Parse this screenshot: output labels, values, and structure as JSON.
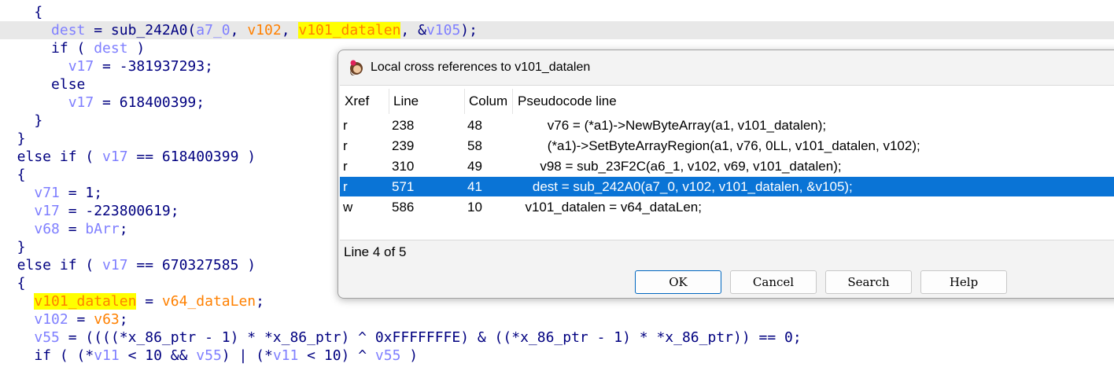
{
  "code_lines": [
    {
      "tokens": [
        {
          "t": "    {",
          "c": "t"
        }
      ]
    },
    {
      "highlighted": true,
      "tokens": [
        {
          "t": "      ",
          "c": "t"
        },
        {
          "t": "dest",
          "c": "v"
        },
        {
          "t": " = sub_242A0(",
          "c": "t"
        },
        {
          "t": "a7_0",
          "c": "v"
        },
        {
          "t": ", ",
          "c": "t"
        },
        {
          "t": "v102",
          "c": "o"
        },
        {
          "t": ", ",
          "c": "t"
        },
        {
          "t": "v101_datalen",
          "c": "y"
        },
        {
          "t": ", &",
          "c": "t"
        },
        {
          "t": "v105",
          "c": "v"
        },
        {
          "t": ");",
          "c": "t"
        }
      ]
    },
    {
      "tokens": [
        {
          "t": "      if ( ",
          "c": "t"
        },
        {
          "t": "dest",
          "c": "v"
        },
        {
          "t": " )",
          "c": "t"
        }
      ]
    },
    {
      "tokens": [
        {
          "t": "        ",
          "c": "t"
        },
        {
          "t": "v17",
          "c": "v"
        },
        {
          "t": " = -381937293;",
          "c": "t"
        }
      ]
    },
    {
      "tokens": [
        {
          "t": "      else",
          "c": "t"
        }
      ]
    },
    {
      "tokens": [
        {
          "t": "        ",
          "c": "t"
        },
        {
          "t": "v17",
          "c": "v"
        },
        {
          "t": " = 618400399;",
          "c": "t"
        }
      ]
    },
    {
      "tokens": [
        {
          "t": "    }",
          "c": "t"
        }
      ]
    },
    {
      "tokens": [
        {
          "t": "  }",
          "c": "t"
        }
      ]
    },
    {
      "tokens": [
        {
          "t": "  else if ( ",
          "c": "t"
        },
        {
          "t": "v17",
          "c": "v"
        },
        {
          "t": " == 618400399 )",
          "c": "t"
        }
      ]
    },
    {
      "tokens": [
        {
          "t": "  {",
          "c": "t"
        }
      ]
    },
    {
      "tokens": [
        {
          "t": "    ",
          "c": "t"
        },
        {
          "t": "v71",
          "c": "v"
        },
        {
          "t": " = 1;",
          "c": "t"
        }
      ]
    },
    {
      "tokens": [
        {
          "t": "    ",
          "c": "t"
        },
        {
          "t": "v17",
          "c": "v"
        },
        {
          "t": " = -223800619;",
          "c": "t"
        }
      ]
    },
    {
      "tokens": [
        {
          "t": "    ",
          "c": "t"
        },
        {
          "t": "v68",
          "c": "v"
        },
        {
          "t": " = ",
          "c": "t"
        },
        {
          "t": "bArr",
          "c": "v"
        },
        {
          "t": ";",
          "c": "t"
        }
      ]
    },
    {
      "tokens": [
        {
          "t": "  }",
          "c": "t"
        }
      ]
    },
    {
      "tokens": [
        {
          "t": "  else if ( ",
          "c": "t"
        },
        {
          "t": "v17",
          "c": "v"
        },
        {
          "t": " == 670327585 )",
          "c": "t"
        }
      ]
    },
    {
      "tokens": [
        {
          "t": "  {",
          "c": "t"
        }
      ]
    },
    {
      "tokens": [
        {
          "t": "    ",
          "c": "t"
        },
        {
          "t": "v101_datalen",
          "c": "y"
        },
        {
          "t": " = ",
          "c": "t"
        },
        {
          "t": "v64_dataLen",
          "c": "o"
        },
        {
          "t": ";",
          "c": "t"
        }
      ]
    },
    {
      "tokens": [
        {
          "t": "    ",
          "c": "t"
        },
        {
          "t": "v102",
          "c": "v"
        },
        {
          "t": " = ",
          "c": "t"
        },
        {
          "t": "v63",
          "c": "o"
        },
        {
          "t": ";",
          "c": "t"
        }
      ]
    },
    {
      "tokens": [
        {
          "t": "    ",
          "c": "t"
        },
        {
          "t": "v55",
          "c": "v"
        },
        {
          "t": " = ((((*x_86_ptr - 1) * *x_86_ptr) ^ 0xFFFFFFFE) & ((*x_86_ptr - 1) * *x_86_ptr)) == 0;",
          "c": "t"
        }
      ]
    },
    {
      "tokens": [
        {
          "t": "    if ( (*",
          "c": "t"
        },
        {
          "t": "v11",
          "c": "v"
        },
        {
          "t": " < 10 && ",
          "c": "t"
        },
        {
          "t": "v55",
          "c": "v"
        },
        {
          "t": ") | (*",
          "c": "t"
        },
        {
          "t": "v11",
          "c": "v"
        },
        {
          "t": " < 10) ^ ",
          "c": "t"
        },
        {
          "t": "v55",
          "c": "v"
        },
        {
          "t": " )",
          "c": "t"
        }
      ]
    }
  ],
  "dialog": {
    "title": "Local cross references to v101_datalen",
    "columns": {
      "xref": "Xref",
      "line": "Line",
      "column": "Colum",
      "pseudocode": "Pseudocode line"
    },
    "rows": [
      {
        "xref": "r",
        "line": "238",
        "column": "48",
        "code": "        v76 = (*a1)->NewByteArray(a1, v101_datalen);",
        "selected": false
      },
      {
        "xref": "r",
        "line": "239",
        "column": "58",
        "code": "        (*a1)->SetByteArrayRegion(a1, v76, 0LL, v101_datalen, v102);",
        "selected": false
      },
      {
        "xref": "r",
        "line": "310",
        "column": "49",
        "code": "      v98 = sub_23F2C(a6_1, v102, v69, v101_datalen);",
        "selected": false
      },
      {
        "xref": "r",
        "line": "571",
        "column": "41",
        "code": "    dest = sub_242A0(a7_0, v102, v101_datalen, &v105);",
        "selected": true
      },
      {
        "xref": "w",
        "line": "586",
        "column": "10",
        "code": "  v101_datalen = v64_dataLen;",
        "selected": false
      }
    ],
    "status": "Line 4 of 5",
    "buttons": {
      "ok": "OK",
      "cancel": "Cancel",
      "search": "Search",
      "help": "Help"
    }
  },
  "colors": {
    "selection": "#0a74d6",
    "code_text": "#000080",
    "variable": "#7f7fff",
    "global": "#ff8000",
    "highlight": "#ffff00"
  },
  "icons": {
    "app": "ida-app-icon"
  }
}
